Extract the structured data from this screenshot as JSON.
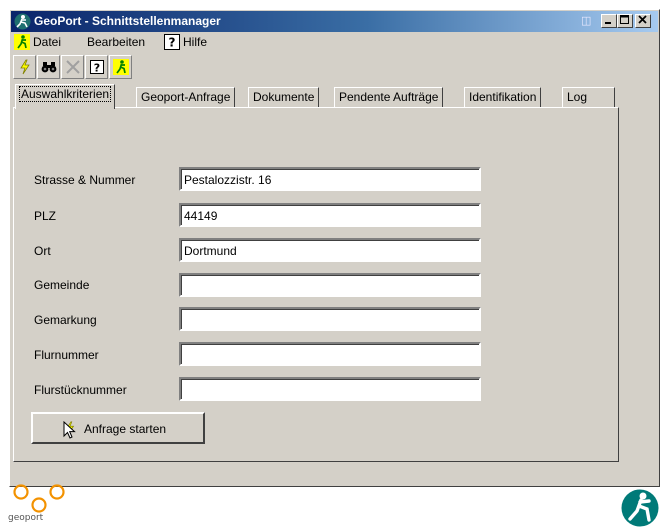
{
  "window": {
    "title": "GeoPort - Schnittstellenmanager",
    "title_controls": [
      "minimize-button",
      "maximize-button",
      "close-button"
    ]
  },
  "menubar": {
    "items": [
      {
        "label": "Datei",
        "icon": "runner-icon"
      },
      {
        "label": "Bearbeiten"
      },
      {
        "label": "Hilfe",
        "icon": "help-icon"
      }
    ]
  },
  "toolbar": {
    "buttons": [
      "lightning-icon",
      "binoculars-icon",
      "cancel-icon",
      "help-icon",
      "runner-icon"
    ]
  },
  "tabs": [
    {
      "label": "Auswahlkriterien",
      "active": true
    },
    {
      "label": "Geoport-Anfrage"
    },
    {
      "label": "Dokumente"
    },
    {
      "label": "Pendente Aufträge"
    },
    {
      "label": "Identifikation"
    },
    {
      "label": "Log"
    }
  ],
  "form": {
    "fields": [
      {
        "label": "Strasse & Nummer",
        "value": "Pestalozzistr. 16"
      },
      {
        "label": "PLZ",
        "value": "44149"
      },
      {
        "label": "Ort",
        "value": "Dortmund"
      },
      {
        "label": "Gemeinde",
        "value": ""
      },
      {
        "label": "Gemarkung",
        "value": ""
      },
      {
        "label": "Flurnummer",
        "value": ""
      },
      {
        "label": "Flurstücknummer",
        "value": ""
      }
    ],
    "submit_label": "Anfrage starten"
  },
  "footer": {
    "logo_text": "geoport"
  },
  "colors": {
    "titlebar_start": "#0a246a",
    "titlebar_end": "#a6caf0",
    "window_face": "#d4d0c8",
    "logo_orange": "#f39200",
    "logo_teal": "#007a78"
  }
}
